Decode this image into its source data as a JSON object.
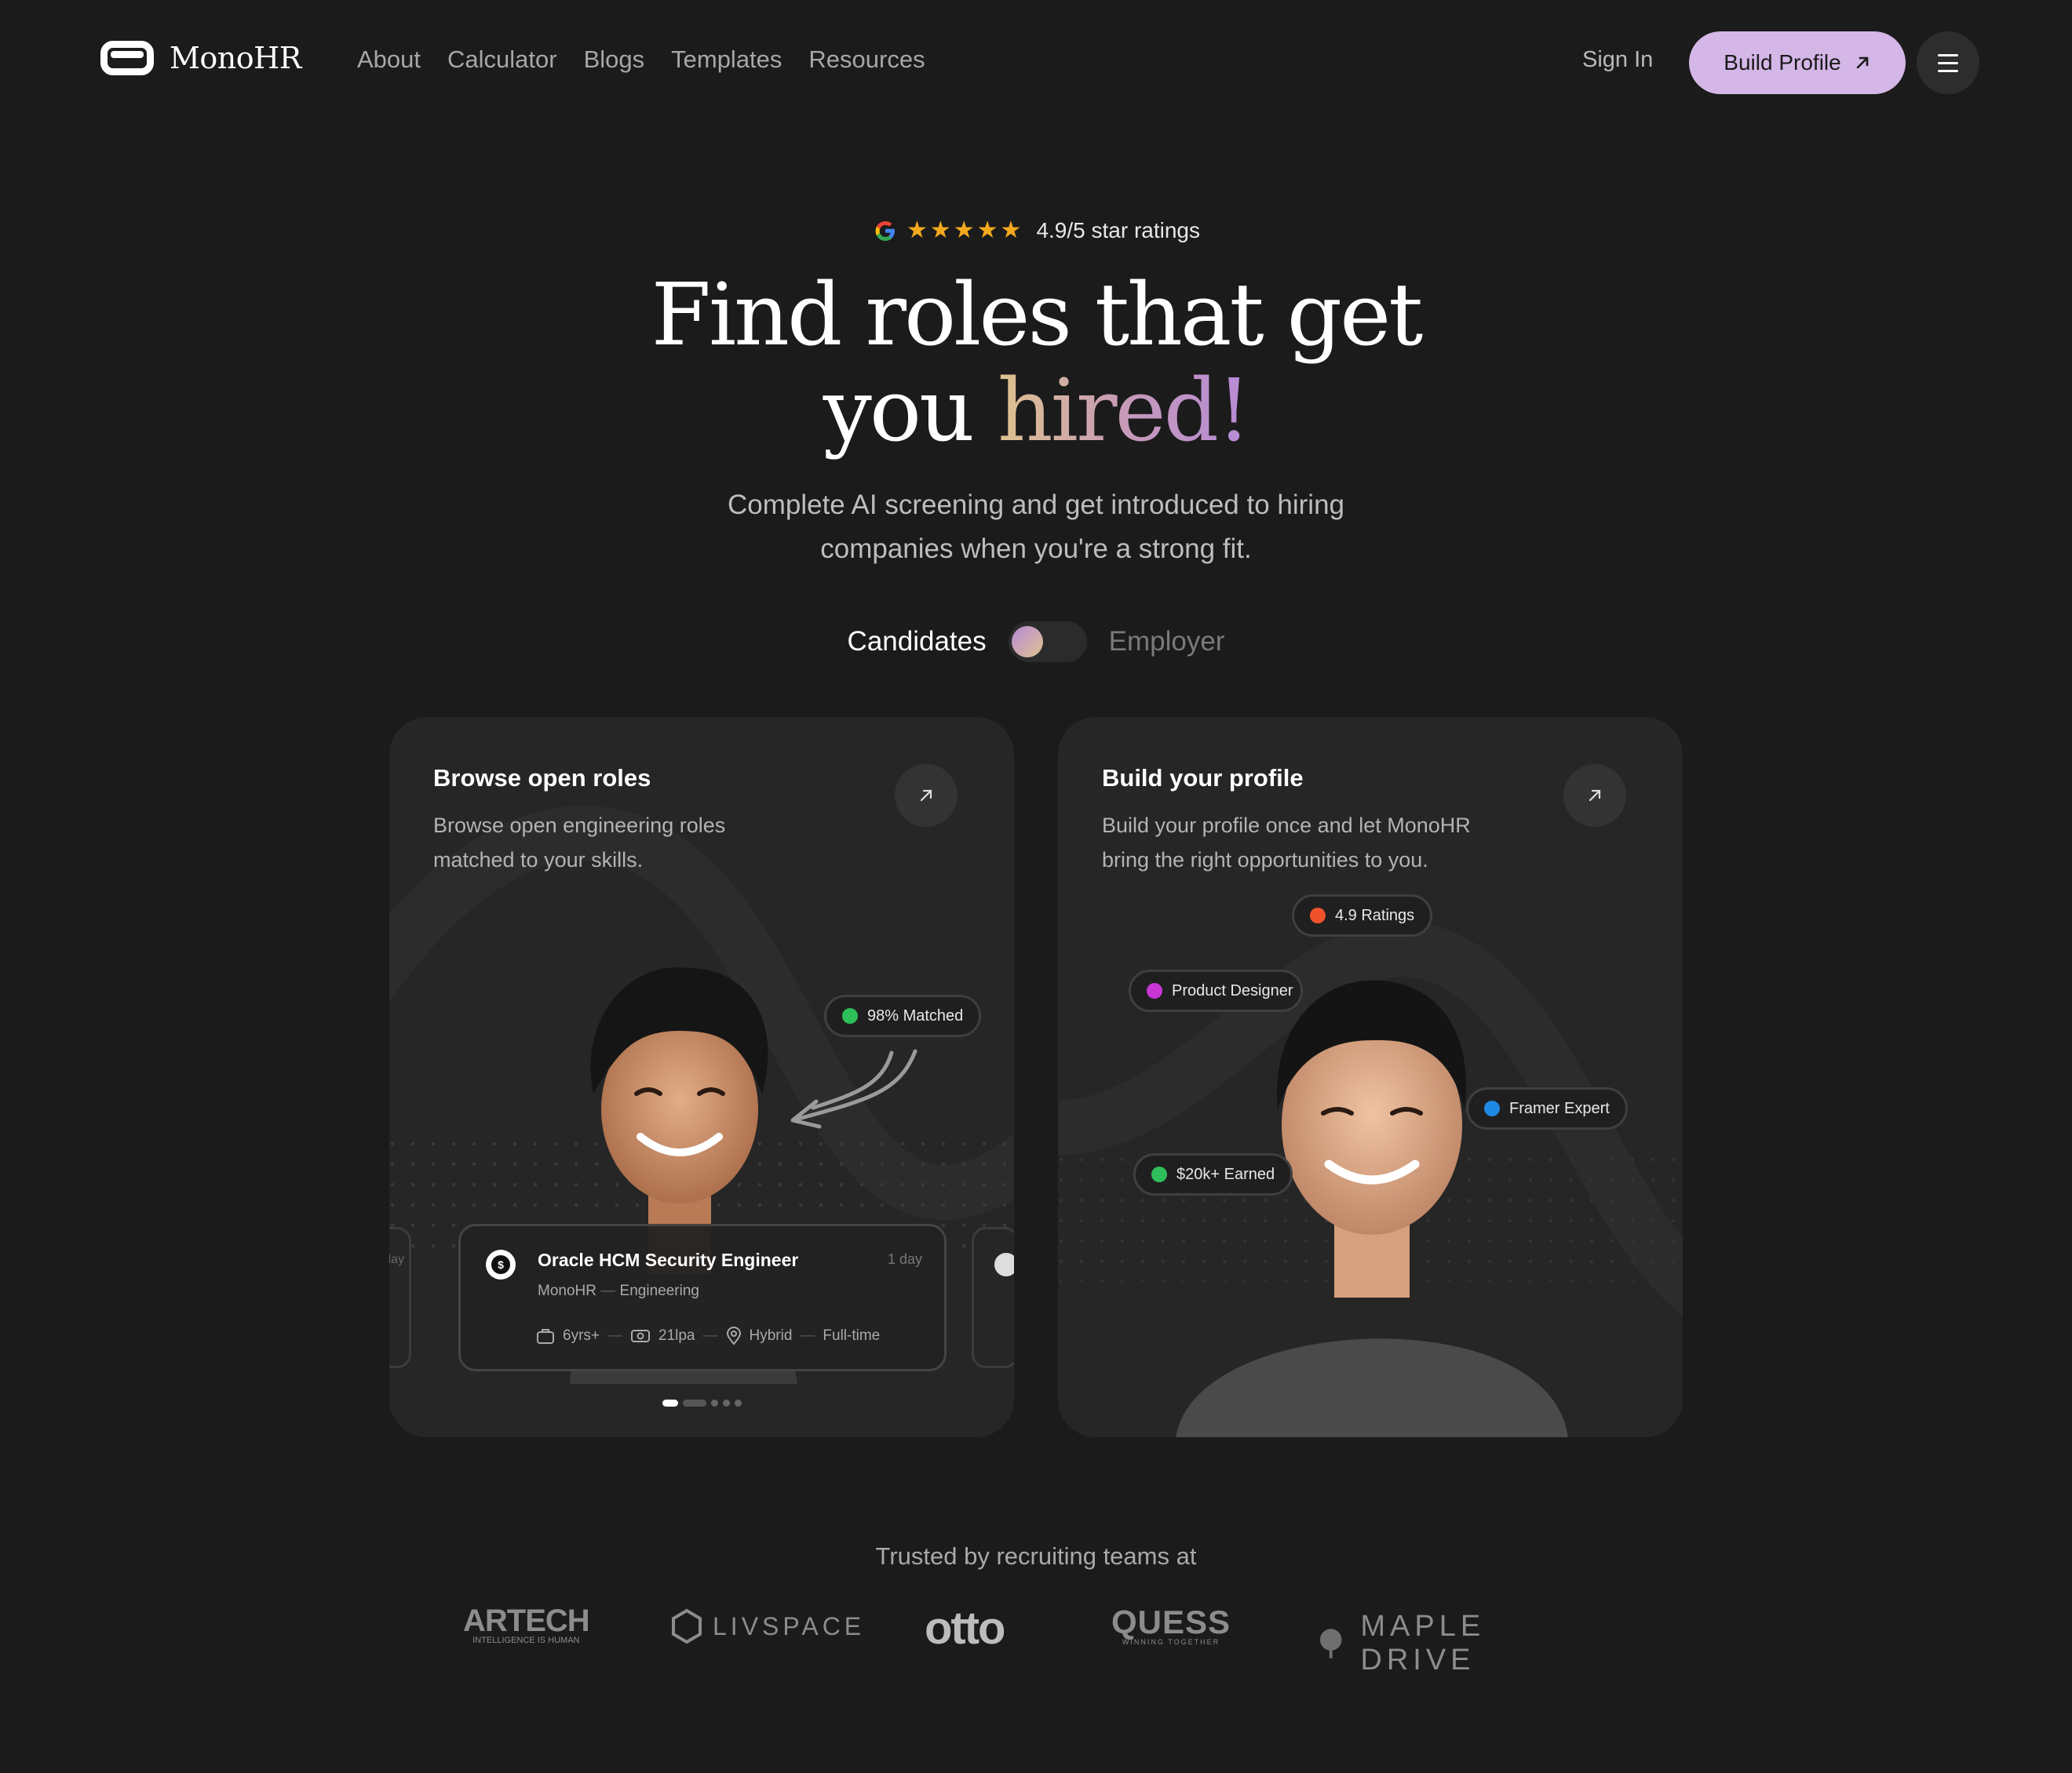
{
  "nav": {
    "brand": "MonoHR",
    "links": [
      "About",
      "Calculator",
      "Blogs",
      "Templates",
      "Resources"
    ],
    "sign_in": "Sign In",
    "build_profile": "Build Profile"
  },
  "hero": {
    "stars": "★★★★★",
    "rating_text": "4.9/5 star ratings",
    "title_line1": "Find roles that get",
    "title_line2_plain": "you ",
    "title_line2_accent": "hired!",
    "subtitle_line1": "Complete AI screening and get introduced to hiring",
    "subtitle_line2": "companies when you're a strong fit.",
    "toggle_left": "Candidates",
    "toggle_right": "Employer"
  },
  "cards": {
    "browse": {
      "title": "Browse open roles",
      "desc_line1": "Browse open engineering roles",
      "desc_line2": "matched to your skills.",
      "match_badge": "98% Matched",
      "prev_card_time": "day",
      "job": {
        "title": "Oracle HCM Security Engineer",
        "time": "1 day",
        "company": "MonoHR",
        "dept_sep": " — ",
        "department": "Engineering",
        "experience": "6yrs+",
        "salary": "21lpa",
        "location": "Hybrid",
        "type": "Full-time"
      }
    },
    "profile": {
      "title": "Build your profile",
      "desc_line1": "Build your profile once and let MonoHR",
      "desc_line2": "bring the right opportunities to you.",
      "badges": {
        "ratings": "4.9 Ratings",
        "role": "Product Designer",
        "expert": "Framer Expert",
        "earned": "$20k+ Earned"
      }
    }
  },
  "trusted": {
    "heading": "Trusted by recruiting teams at",
    "logos": {
      "artech": "ARTECH",
      "artech_tag": "INTELLIGENCE IS HUMAN",
      "livspace": "LIVSPACE",
      "otto": "otto",
      "quess": "QUESS",
      "quess_tag": "WINNING TOGETHER",
      "maple": "MAPLE DRIVE"
    }
  },
  "colors": {
    "background": "#1b1b1b",
    "card": "#262626",
    "accent_button": "#d4b6e7",
    "star": "#f4a91d",
    "match_green": "#2fbf5a",
    "ratings_red": "#f0532b",
    "designer_pink": "#c837d6",
    "expert_blue": "#1e88e5",
    "earned_green": "#2fbf5a"
  }
}
